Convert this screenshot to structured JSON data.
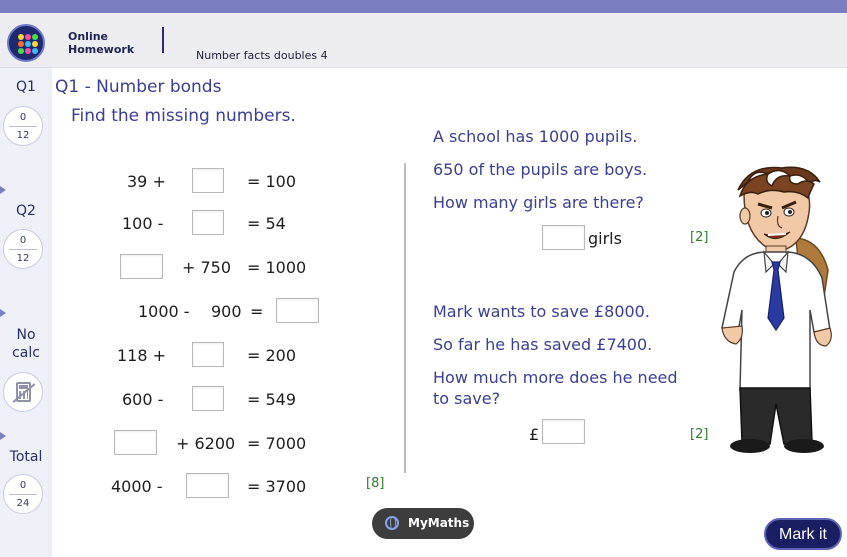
{
  "header": {
    "brand_line1": "Online",
    "brand_line2": "Homework",
    "topic": "Number facts doubles 4"
  },
  "sidebar": {
    "q1": {
      "label": "Q1",
      "score": "0",
      "max": "12"
    },
    "q2": {
      "label": "Q2",
      "score": "0",
      "max": "12"
    },
    "no_calc_line1": "No",
    "no_calc_line2": "calc",
    "total": {
      "label": "Total",
      "score": "0",
      "max": "24"
    }
  },
  "question": {
    "title": "Q1 - Number bonds",
    "instruction": "Find the missing numbers."
  },
  "equations": {
    "e1": {
      "left": "39 +",
      "right": "= 100"
    },
    "e2": {
      "left": "100 -",
      "right": "= 54"
    },
    "e3": {
      "middle": "+ 750",
      "right": "= 1000"
    },
    "e4": {
      "left": "1000 -",
      "middle": "900",
      "eq": "="
    },
    "e5": {
      "left": "118 +",
      "right": "= 200"
    },
    "e6": {
      "left": "600 -",
      "right": "= 549"
    },
    "e7": {
      "middle": "+ 6200",
      "right": "= 7000"
    },
    "e8": {
      "left": "4000 -",
      "right": "= 3700"
    },
    "marks": "[8]"
  },
  "problem1": {
    "line1": "A school has 1000 pupils.",
    "line2": "650 of the pupils are boys.",
    "line3": "How many girls are there?",
    "unit": "girls",
    "marks": "[2]"
  },
  "problem2": {
    "line1": "Mark wants to save £8000.",
    "line2": "So far he has saved £7400.",
    "line3": "How much more does he need",
    "line4": "to save?",
    "currency": "£",
    "marks": "[2]"
  },
  "footer": {
    "mymaths_label": "MyMaths",
    "mark_button": "Mark it"
  },
  "colors": {
    "accent": "#7b7fc1",
    "question_text": "#3a3f8f",
    "marks_green": "#2f7d2f",
    "mark_button": "#1a1f64"
  },
  "icons": {
    "logo": "mymaths-logo-icon",
    "calculator": "no-calculator-icon",
    "globe": "globe-icon"
  }
}
